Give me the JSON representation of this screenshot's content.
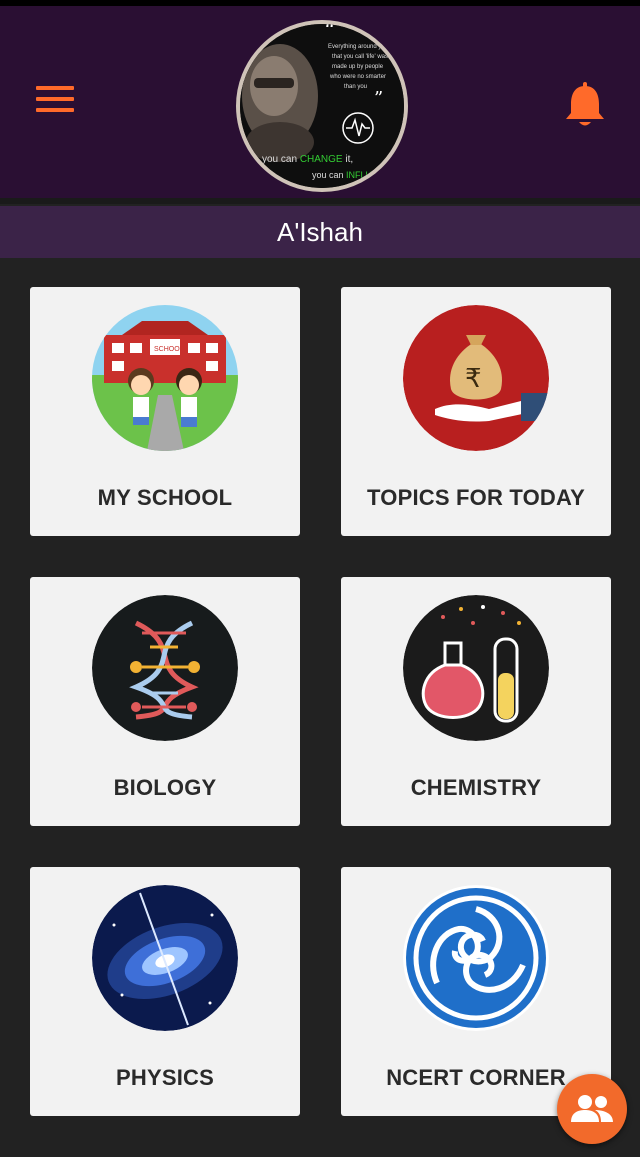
{
  "header": {
    "menu_icon": "hamburger-menu-icon",
    "notification_icon": "bell-icon",
    "avatar": {
      "quote_top": "Everything around you that you call 'life' was made up by people who were no smarter than you",
      "quote_bottom_1": "you can CHANGE it,",
      "quote_bottom_2": "you can INFLUENCE it"
    }
  },
  "user": {
    "name": "A'Ishah"
  },
  "cards": [
    {
      "label": "MY SCHOOL",
      "icon": "school-icon"
    },
    {
      "label": "TOPICS FOR TODAY",
      "icon": "money-bag-icon"
    },
    {
      "label": "BIOLOGY",
      "icon": "dna-icon"
    },
    {
      "label": "CHEMISTRY",
      "icon": "flask-icon"
    },
    {
      "label": "PHYSICS",
      "icon": "galaxy-icon"
    },
    {
      "label": "NCERT CORNER",
      "icon": "ncert-logo-icon"
    }
  ],
  "fab": {
    "icon": "group-icon"
  },
  "colors": {
    "accent": "#f26a2b",
    "header_bg": "#2a0f33",
    "namebar_bg": "#3b2348",
    "background": "#222222",
    "card_bg": "#f2f2f2"
  }
}
